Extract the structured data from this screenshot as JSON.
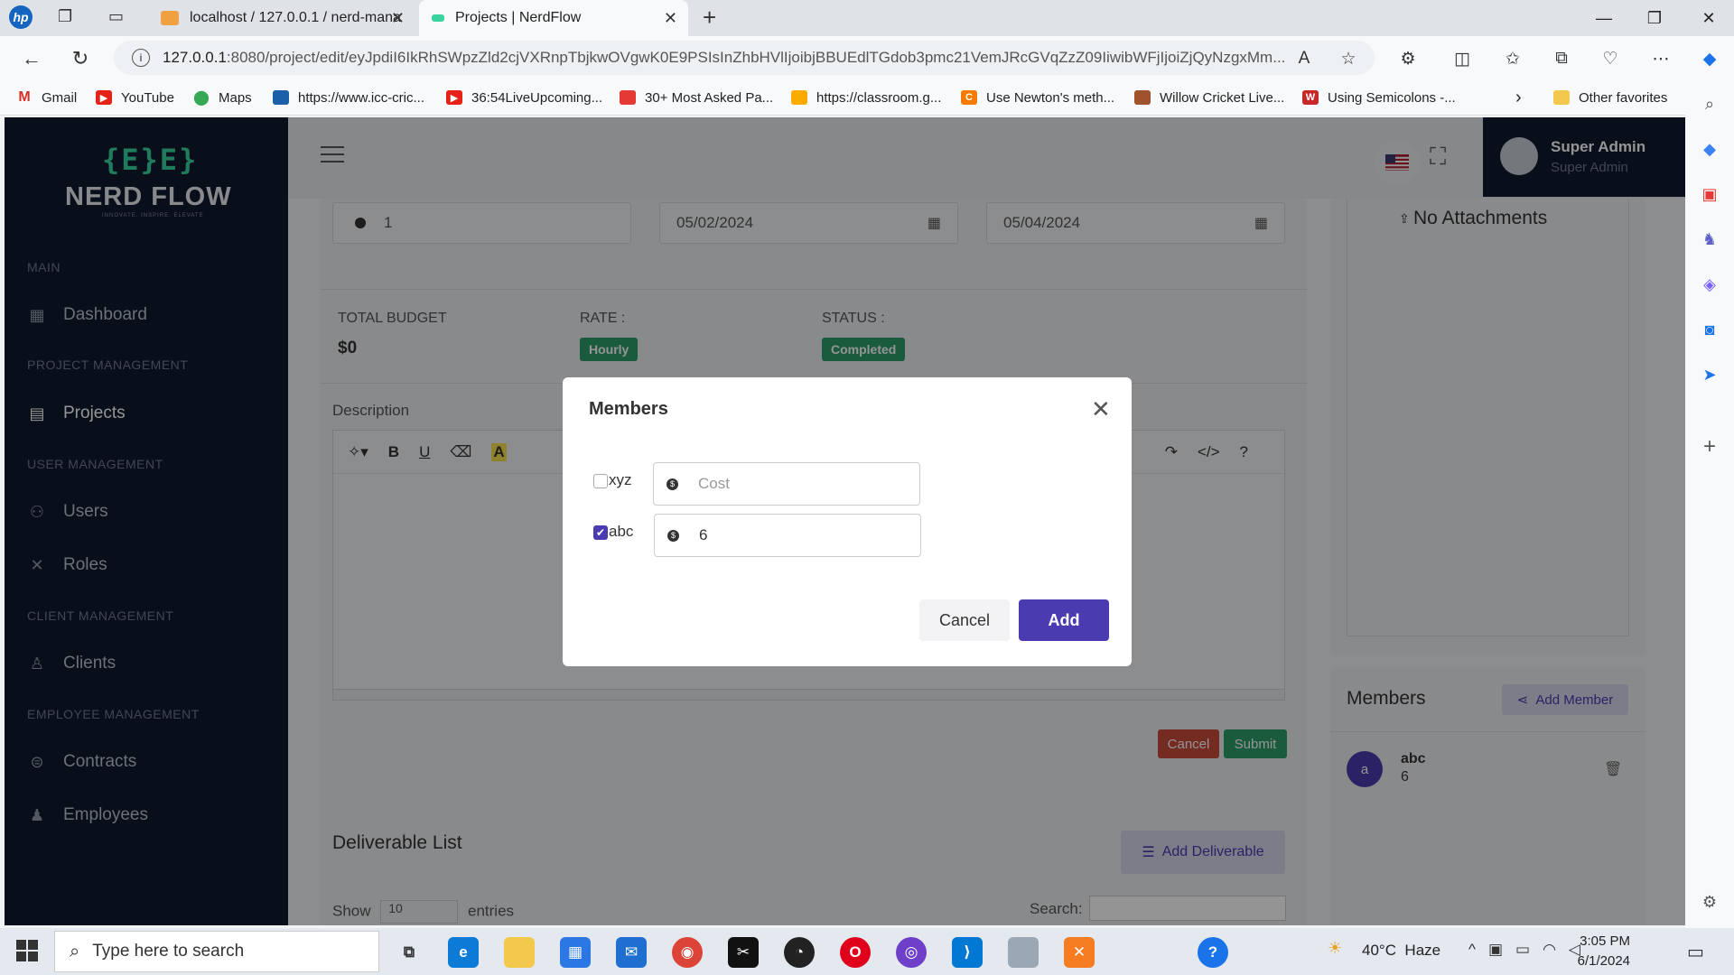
{
  "browser": {
    "tabs": [
      {
        "title": "localhost / 127.0.0.1 / nerd-mana"
      },
      {
        "title": "Projects | NerdFlow"
      }
    ],
    "url_host": "127.0.0.1",
    "url_path": ":8080/project/edit/eyJpdiI6IkRhSWpzZld2cjVXRnpTbjkwOVgwK0E9PSIsInZhbHVlIjoibjBBUEdlTGdob3pmc21VemJRcGVqZzZ09IiwibWFjIjoiZjQyNzgxMm...",
    "bookmarks": [
      "Gmail",
      "YouTube",
      "Maps",
      "https://www.icc-cric...",
      "36:54LiveUpcoming...",
      "30+ Most Asked Pa...",
      "https://classroom.g...",
      "Use Newton's meth...",
      "Willow Cricket Live...",
      "Using Semicolons -..."
    ],
    "other_favorites": "Other favorites"
  },
  "sidebar": {
    "logo_mark": "{E}E}",
    "logo_text": "NERD FLOW",
    "logo_tagline": "INNOVATE. INSPIRE. ELEVATE",
    "sections": {
      "main": "MAIN",
      "project": "PROJECT MANAGEMENT",
      "user": "USER MANAGEMENT",
      "client": "CLIENT MANAGEMENT",
      "employee": "EMPLOYEE MANAGEMENT"
    },
    "items": {
      "dashboard": "Dashboard",
      "projects": "Projects",
      "users": "Users",
      "roles": "Roles",
      "clients": "Clients",
      "contracts": "Contracts",
      "employees": "Employees"
    }
  },
  "header": {
    "user_name": "Super Admin",
    "user_role": "Super Admin"
  },
  "form": {
    "amount": "1",
    "start_date": "05/02/2024",
    "end_date": "05/04/2024",
    "total_budget_label": "TOTAL BUDGET",
    "total_budget_value": "$0",
    "rate_label": "RATE :",
    "rate_value": "Hourly",
    "status_label": "STATUS :",
    "status_value": "Completed",
    "description_label": "Description",
    "cancel": "Cancel",
    "submit": "Submit"
  },
  "attachments": {
    "text": "No Attachments"
  },
  "members_panel": {
    "title": "Members",
    "add_button": "Add Member",
    "members": [
      {
        "initial": "a",
        "name": "abc",
        "cost": "6"
      }
    ]
  },
  "deliverables": {
    "title": "Deliverable List",
    "add_button": "Add Deliverable",
    "show": "Show",
    "entries_value": "10",
    "entries": "entries",
    "search": "Search:"
  },
  "modal": {
    "title": "Members",
    "rows": [
      {
        "name": "xyz",
        "checked": false,
        "cost_value": "",
        "cost_placeholder": "Cost"
      },
      {
        "name": "abc",
        "checked": true,
        "cost_value": "6",
        "cost_placeholder": "Cost"
      }
    ],
    "cancel": "Cancel",
    "add": "Add"
  },
  "taskbar": {
    "search_placeholder": "Type here to search",
    "weather": "40°C  Haze",
    "time": "3:05 PM",
    "date": "6/1/2024"
  }
}
